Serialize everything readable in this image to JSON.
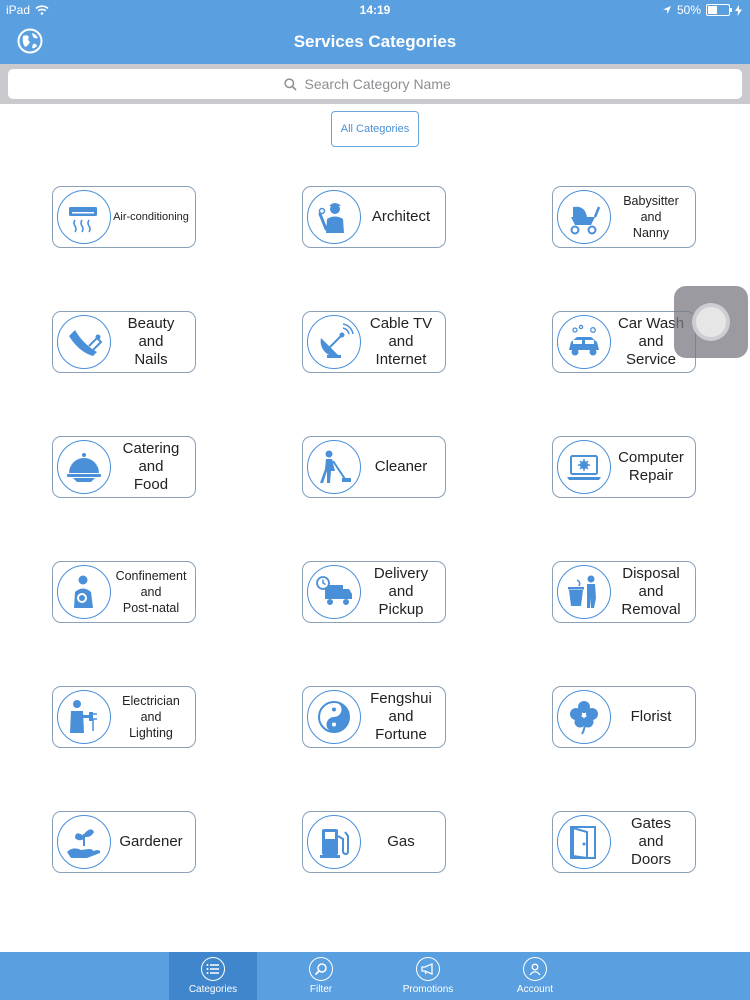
{
  "status": {
    "device": "iPad",
    "time": "14:19",
    "battery": "50%",
    "battery_level": 0.5
  },
  "header": {
    "title": "Services Categories"
  },
  "search": {
    "placeholder": "Search Category Name"
  },
  "filter": {
    "all_label": "All Categories"
  },
  "categories": [
    {
      "label": "Air-conditioning",
      "icon": "air-conditioner-icon"
    },
    {
      "label": "Architect",
      "icon": "architect-icon"
    },
    {
      "label": "Babysitter\nand\nNanny",
      "icon": "stroller-icon"
    },
    {
      "label": "Beauty\nand\nNails",
      "icon": "nail-polish-icon"
    },
    {
      "label": "Cable TV\nand\nInternet",
      "icon": "satellite-dish-icon"
    },
    {
      "label": "Car Wash\nand\nService",
      "icon": "car-wash-icon"
    },
    {
      "label": "Catering\nand\nFood",
      "icon": "cloche-icon"
    },
    {
      "label": "Cleaner",
      "icon": "vacuum-cleaner-icon"
    },
    {
      "label": "Computer\nRepair",
      "icon": "laptop-gear-icon"
    },
    {
      "label": "Confinement\nand\nPost-natal",
      "icon": "mother-baby-icon"
    },
    {
      "label": "Delivery\nand\nPickup",
      "icon": "delivery-truck-icon"
    },
    {
      "label": "Disposal\nand\nRemoval",
      "icon": "trash-bin-icon"
    },
    {
      "label": "Electrician\nand\nLighting",
      "icon": "electrician-icon"
    },
    {
      "label": "Fengshui\nand\nFortune",
      "icon": "yin-yang-icon"
    },
    {
      "label": "Florist",
      "icon": "flower-icon"
    },
    {
      "label": "Gardener",
      "icon": "plant-hand-icon"
    },
    {
      "label": "Gas",
      "icon": "gas-pump-icon"
    },
    {
      "label": "Gates\nand\nDoors",
      "icon": "door-icon"
    }
  ],
  "tabs": [
    {
      "label": "Categories",
      "icon": "list-icon",
      "active": true
    },
    {
      "label": "Filter",
      "icon": "magnifier-icon",
      "active": false
    },
    {
      "label": "Promotions",
      "icon": "megaphone-icon",
      "active": false
    },
    {
      "label": "Account",
      "icon": "user-icon",
      "active": false
    }
  ],
  "colors": {
    "brand": "#5a9fdf",
    "tab_active": "#3f86cc",
    "icon_blue": "#4a90d9",
    "card_border": "#8aa0b8"
  }
}
